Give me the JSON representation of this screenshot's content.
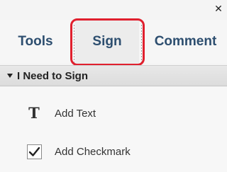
{
  "window": {
    "close_icon": "close-icon"
  },
  "tabs": [
    {
      "label": "Tools",
      "selected": false
    },
    {
      "label": "Sign",
      "selected": true,
      "highlighted": true
    },
    {
      "label": "Comment",
      "selected": false
    }
  ],
  "section": {
    "title": "I Need to Sign",
    "expanded": true,
    "icon": "caret-down-icon"
  },
  "items": [
    {
      "label": "Add Text",
      "icon": "text-t-icon"
    },
    {
      "label": "Add Checkmark",
      "icon": "checkmark-icon"
    }
  ],
  "colors": {
    "tab_text": "#2d4e6f",
    "highlight": "#e0202e",
    "background": "#f4f4f4"
  }
}
